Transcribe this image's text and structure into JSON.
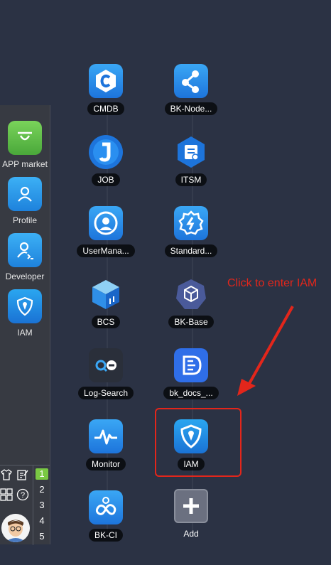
{
  "dock": {
    "items": [
      {
        "label": "APP market",
        "icon": "shopping-bag-icon",
        "color": "#5cb84a"
      },
      {
        "label": "Profile",
        "icon": "user-icon",
        "color": "#2d9ae8"
      },
      {
        "label": "Developer",
        "icon": "developer-icon",
        "color": "#2d9ae8"
      },
      {
        "label": "IAM",
        "icon": "shield-icon",
        "color": "#1e8fe0"
      }
    ],
    "pages": [
      "1",
      "2",
      "3",
      "4",
      "5"
    ],
    "active_page": "1"
  },
  "apps": [
    {
      "label": "CMDB",
      "icon": "cmdb-icon",
      "color": "#2f8fe8"
    },
    {
      "label": "BK-Node...",
      "icon": "node-icon",
      "color": "#2f8fe8"
    },
    {
      "label": "JOB",
      "icon": "job-icon",
      "color": "#2f8fe8"
    },
    {
      "label": "ITSM",
      "icon": "itsm-icon",
      "color": "#2f8fe8"
    },
    {
      "label": "UserMana...",
      "icon": "user-manage-icon",
      "color": "#2f8fe8"
    },
    {
      "label": "Standard...",
      "icon": "gear-icon",
      "color": "#2f8fe8"
    },
    {
      "label": "BCS",
      "icon": "cube-icon",
      "color": "#2f8fe8"
    },
    {
      "label": "BK-Base",
      "icon": "bk-base-icon",
      "color": "#4a5a9a"
    },
    {
      "label": "Log-Search",
      "icon": "log-search-icon",
      "color": "#2a2f3a"
    },
    {
      "label": "bk_docs_...",
      "icon": "docs-icon",
      "color": "#2f6ee8"
    },
    {
      "label": "Monitor",
      "icon": "monitor-icon",
      "color": "#2f8fe8"
    },
    {
      "label": "IAM",
      "icon": "shield-icon",
      "color": "#1e8fe0"
    },
    {
      "label": "BK-CI",
      "icon": "bk-ci-icon",
      "color": "#2f8fe8"
    },
    {
      "label": "Add",
      "icon": "plus-icon",
      "color": "#6b7080"
    }
  ],
  "annotation": {
    "text": "Click to enter IAM",
    "color": "#e3261b"
  }
}
